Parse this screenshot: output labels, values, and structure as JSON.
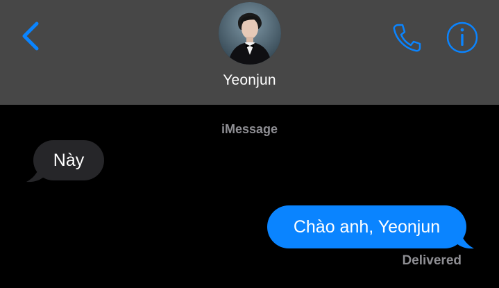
{
  "header": {
    "contact_name": "Yeonjun",
    "back_icon": "chevron-left-icon",
    "call_icon": "phone-icon",
    "info_icon": "info-icon",
    "background_color": "#474747",
    "accent_color": "#0a84ff"
  },
  "conversation": {
    "service_label": "iMessage",
    "messages": [
      {
        "direction": "incoming",
        "text": "Này",
        "bubble_color": "#262629"
      },
      {
        "direction": "outgoing",
        "text": "Chào anh, Yeonjun",
        "bubble_color": "#0a84ff"
      }
    ],
    "status": "Delivered"
  }
}
